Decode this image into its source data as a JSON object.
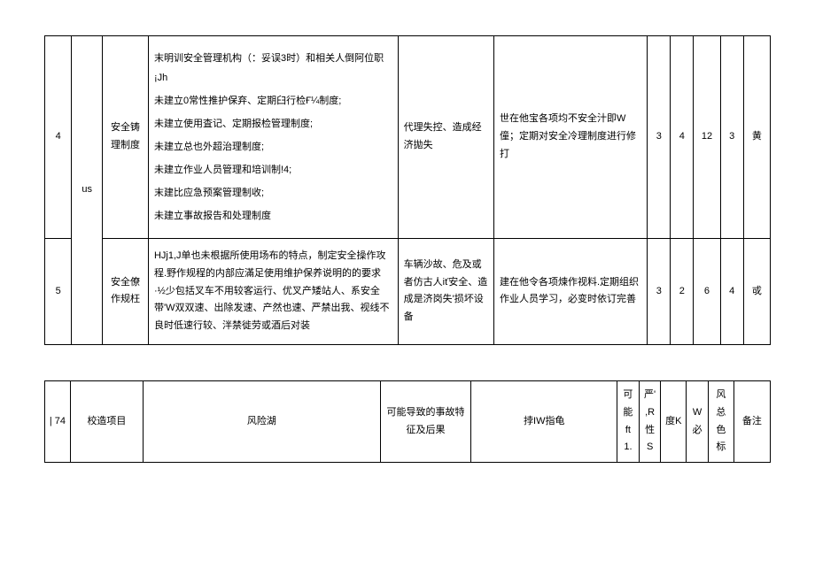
{
  "table1": {
    "rows": [
      {
        "seq": "4",
        "us": "us",
        "category": "安全铸理制度",
        "desc_lines": [
          "末明训安全管理机构（：妥误3时）和相关人倒阿位职¡Jh",
          "未建立0常性推护保弃、定期臼行检Ғ¼制度;",
          "未建立使用査记、定期报检管理制度;",
          "未建立总也外超治理制度;",
          "未建立作业人员管理和培训制!4;",
          "末建比应急预案管理制收;",
          "未建立事故报告和处理制度"
        ],
        "consequence": "代理失控、造成经济拋失",
        "measure": "世在他宝各项均不安全汁即W僮；定期对安全冷理制度进行修打",
        "v1": "3",
        "v2": "4",
        "v3": "12",
        "v4": "3",
        "color": "黄"
      },
      {
        "seq": "5",
        "us": "",
        "category": "安全僚作规枉",
        "desc_single": "HJj1,J单也未根据所使用场布的特点，制定安全操作攻程.野作规程的内部应滿足使用维护保养说明的的要求·½少包括叉车不用较客运行、优叉产矮站人、系安全带'W双双速、出除发速、产然也速、严禁出我、视线不良时低速行较、泮禁徙劳或酒后对装",
        "consequence": "车辆沙故、危及或者仿古人iť安全、造成是济岗失'损坏设备",
        "measure": "建在他令各项煉作视料.定期组织作业人员学习，必变时依订完善",
        "v1": "3",
        "v2": "2",
        "v3": "6",
        "v4": "4",
        "color": "戓"
      }
    ]
  },
  "table2": {
    "headers": {
      "h1": "| 74",
      "h2": "校造项目",
      "h3": "风险湖",
      "h4": "可能导致的事故特征及后果",
      "h5": "挬IW指龟",
      "h6a": "可能",
      "h6b": "ft",
      "h6c": "1.",
      "h7a": "严',R",
      "h7b": "性",
      "h7c": "S",
      "h8": "度K",
      "h9a": "W必",
      "h10a": "风总",
      "h10b": "色标",
      "h11": "备注"
    }
  }
}
